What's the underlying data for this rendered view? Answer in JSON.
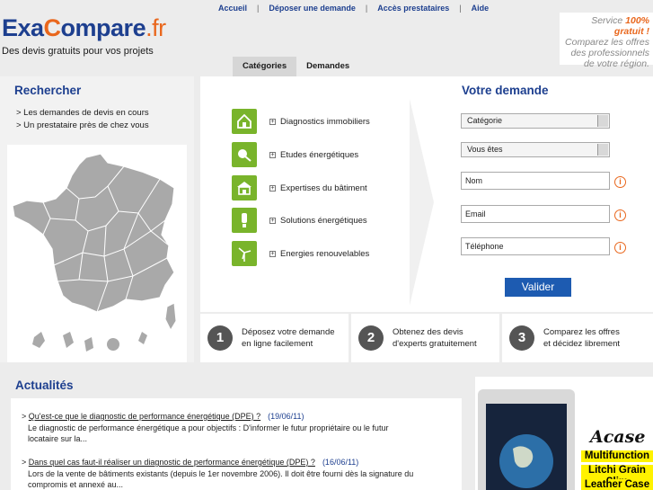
{
  "topnav": {
    "accueil": "Accueil",
    "deposer": "Déposer une demande",
    "acces": "Accès prestataires",
    "aide": "Aide"
  },
  "logo": {
    "part1": "Exa",
    "part2": "C",
    "part3": "ompare",
    "part4": ".fr",
    "tagline": "Des devis gratuits pour vos projets"
  },
  "service": {
    "line1a": "Service ",
    "line1b": "100% gratuit !",
    "line2": "Comparez les offres",
    "line3": "des professionnels",
    "line4": "de votre région."
  },
  "tabs": {
    "categories": "Catégories",
    "demandes": "Demandes"
  },
  "rechercher": {
    "title": "Rechercher",
    "link1": "> Les demandes de devis en cours",
    "link2": "> Un prestataire près de chez vous"
  },
  "categories": [
    {
      "label": "Diagnostics immobiliers",
      "icon": "house-icon"
    },
    {
      "label": "Etudes énergétiques",
      "icon": "plug-icon"
    },
    {
      "label": "Expertises du bâtiment",
      "icon": "building-icon"
    },
    {
      "label": "Solutions énergétiques",
      "icon": "bulb-icon"
    },
    {
      "label": "Energies renouvelables",
      "icon": "wind-turbine-icon"
    }
  ],
  "form": {
    "title": "Votre demande",
    "categorie": "Catégorie",
    "vous_etes": "Vous êtes",
    "nom": "Nom",
    "email": "Email",
    "telephone": "Téléphone",
    "info": "i",
    "valider": "Valider"
  },
  "steps": [
    {
      "num": "1",
      "line1": "Déposez votre demande",
      "line2": "en ligne facilement"
    },
    {
      "num": "2",
      "line1": "Obtenez des devis",
      "line2": "d'experts gratuitement"
    },
    {
      "num": "3",
      "line1": "Comparez les offres",
      "line2": "et décidez librement"
    }
  ],
  "actualites": {
    "title": "Actualités",
    "items": [
      {
        "title": "Qu'est-ce que le diagnostic de performance énergétique (DPE) ?",
        "date": "(19/06/11)",
        "desc1": "Le diagnostic de performance énergétique a pour objectifs : D'informer le futur propriétaire ou le futur",
        "desc2": "locataire sur la..."
      },
      {
        "title": "Dans quel cas faut-il réaliser un diagnostic de performance énergétique (DPE) ?",
        "date": "(16/06/11)",
        "desc1": "Lors de la vente de bâtiments existants (depuis le 1er novembre 2006). Il doit être fourni dès la signature du",
        "desc2": "compromis et annexé au..."
      }
    ]
  },
  "ad": {
    "brand": "Acase",
    "line1": "Multifunction",
    "line2": "Litchi Grain Slim",
    "line3": "Leather Case"
  },
  "colors": {
    "brand_blue": "#1d3f8f",
    "brand_orange": "#e9671d",
    "category_green": "#79b42b",
    "button_blue": "#1d5bb1"
  }
}
